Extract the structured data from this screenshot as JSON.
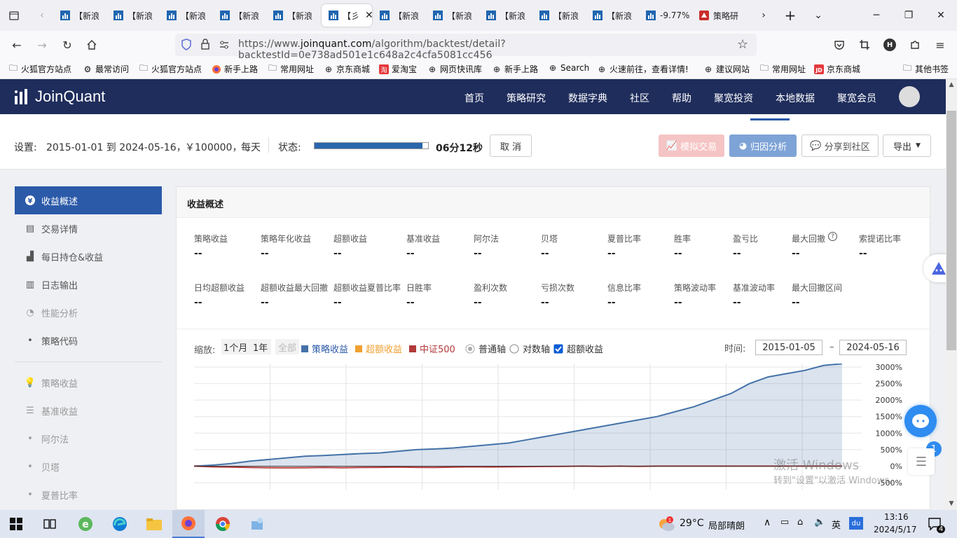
{
  "browser": {
    "tabs": [
      {
        "label": "【新浪"
      },
      {
        "label": "【新浪"
      },
      {
        "label": "【新浪"
      },
      {
        "label": "【新浪"
      },
      {
        "label": "【新浪"
      },
      {
        "label": "【彡"
      },
      {
        "label": "【新浪"
      },
      {
        "label": "【新浪"
      },
      {
        "label": "【新浪"
      },
      {
        "label": "【新浪"
      },
      {
        "label": "【新浪"
      },
      {
        "label": "-9.77%"
      },
      {
        "label": "策略研"
      }
    ],
    "url_prefix": "https://www.",
    "url_domain": "joinquant.com",
    "url_path": "/algorithm/backtest/detail?backtestId=0e738ad501e1c648a2c4cfa5081cc456",
    "bookmarks": [
      "火狐官方站点",
      "最常访问",
      "火狐官方站点",
      "新手上路",
      "常用网址",
      "京东商城",
      "爱淘宝",
      "网页快讯库",
      "新手上路",
      "Search",
      "火速前往，查看详情!",
      "建议网站",
      "常用网址",
      "京东商城",
      "其他书签"
    ]
  },
  "site": {
    "logo": "JoinQuant",
    "menu": [
      "首页",
      "策略研究",
      "数据字典",
      "社区",
      "帮助",
      "聚宽投资",
      "本地数据",
      "聚宽会员"
    ]
  },
  "settings": {
    "label": "设置:",
    "range": "2015-01-01 到 2024-05-16，",
    "capital": "￥100000，",
    "freq": "每天",
    "status_label": "状态:",
    "progress": 0.95,
    "elapsed": "06分12秒",
    "cancel": "取 消",
    "sim_trade": "模拟交易",
    "attribution": "归因分析",
    "share": "分享到社区",
    "export": "导出"
  },
  "sidebar": {
    "items": [
      {
        "label": "收益概述",
        "icon": "yen-icon"
      },
      {
        "label": "交易详情",
        "icon": "list-icon"
      },
      {
        "label": "每日持仓&收益",
        "icon": "bars-icon"
      },
      {
        "label": "日志输出",
        "icon": "log-icon"
      },
      {
        "label": "性能分析",
        "icon": "pie-icon"
      },
      {
        "label": "策略代码",
        "icon": "dot"
      },
      {
        "label": "策略收益",
        "icon": "bulb-icon"
      },
      {
        "label": "基准收益",
        "icon": "db-icon"
      },
      {
        "label": "阿尔法",
        "icon": "dot"
      },
      {
        "label": "贝塔",
        "icon": "dot"
      },
      {
        "label": "夏普比率",
        "icon": "dot"
      }
    ]
  },
  "panel": {
    "title": "收益概述",
    "metrics_row1": [
      {
        "label": "策略收益",
        "value": "--"
      },
      {
        "label": "策略年化收益",
        "value": "--"
      },
      {
        "label": "超额收益",
        "value": "--"
      },
      {
        "label": "基准收益",
        "value": "--"
      },
      {
        "label": "阿尔法",
        "value": "--"
      },
      {
        "label": "贝塔",
        "value": "--"
      },
      {
        "label": "夏普比率",
        "value": "--"
      },
      {
        "label": "胜率",
        "value": "--"
      },
      {
        "label": "盈亏比",
        "value": "--"
      },
      {
        "label": "最大回撤",
        "value": "--"
      },
      {
        "label": "索提诺比率",
        "value": "--"
      }
    ],
    "metrics_row2": [
      {
        "label": "日均超额收益",
        "value": "--"
      },
      {
        "label": "超额收益最大回撤",
        "value": "--"
      },
      {
        "label": "超额收益夏普比率",
        "value": "--"
      },
      {
        "label": "日胜率",
        "value": "--"
      },
      {
        "label": "盈利次数",
        "value": "--"
      },
      {
        "label": "亏损次数",
        "value": "--"
      },
      {
        "label": "信息比率",
        "value": "--"
      },
      {
        "label": "策略波动率",
        "value": "--"
      },
      {
        "label": "基准波动率",
        "value": "--"
      },
      {
        "label": "最大回撤区间",
        "value": "--"
      }
    ],
    "controls": {
      "zoom": "缩放:",
      "m1": "1个月",
      "y1": "1年",
      "all": "全部",
      "legend_strategy": "策略收益",
      "legend_excess": "超额收益",
      "legend_bench": "中证500",
      "normal_axis": "普通轴",
      "log_axis": "对数轴",
      "excess_check": "超额收益",
      "time_label": "时间:",
      "date_from": "2015-01-05",
      "date_to": "2024-05-16",
      "dash": "–"
    }
  },
  "chart_data": {
    "type": "area",
    "title": "",
    "y_ticks": [
      "3000%",
      "2500%",
      "2000%",
      "1500%",
      "1000%",
      "500%",
      "0%",
      "-500%"
    ],
    "ylim": [
      -500,
      3000
    ],
    "series": [
      {
        "name": "策略收益",
        "color": "#4472a8",
        "values": [
          0,
          30,
          80,
          150,
          200,
          250,
          300,
          320,
          350,
          380,
          400,
          450,
          500,
          520,
          550,
          600,
          650,
          700,
          800,
          900,
          1000,
          1100,
          1200,
          1300,
          1400,
          1500,
          1650,
          1800,
          2000,
          2200,
          2500,
          2700,
          2800,
          2900,
          3050,
          3100
        ]
      },
      {
        "name": "中证500",
        "color": "#b13a3a",
        "values": [
          0,
          -20,
          -30,
          -40,
          -45,
          -50,
          -45,
          -40,
          -45,
          -40,
          -35,
          -30,
          -35,
          -40,
          -30,
          -20,
          -25,
          -20,
          -15,
          -10,
          -5,
          0,
          -5,
          0,
          -5,
          0,
          0,
          0,
          0,
          0,
          0,
          0,
          0,
          0,
          0,
          0
        ]
      }
    ]
  },
  "watermark": {
    "line1": "激活 Windows",
    "line2": "转到\"设置\"以激活 Windows。"
  },
  "taskbar": {
    "weather": "29°C",
    "weather_desc": "局部晴朗",
    "ime": "英",
    "time": "13:16",
    "date": "2024/5/17",
    "notif": "4",
    "help_badge": "1"
  },
  "colors": {
    "navy": "#1f2d5c",
    "accent": "#2b5aa8",
    "strategy": "#4472a8",
    "excess": "#f0a030",
    "bench": "#b13a3a"
  }
}
